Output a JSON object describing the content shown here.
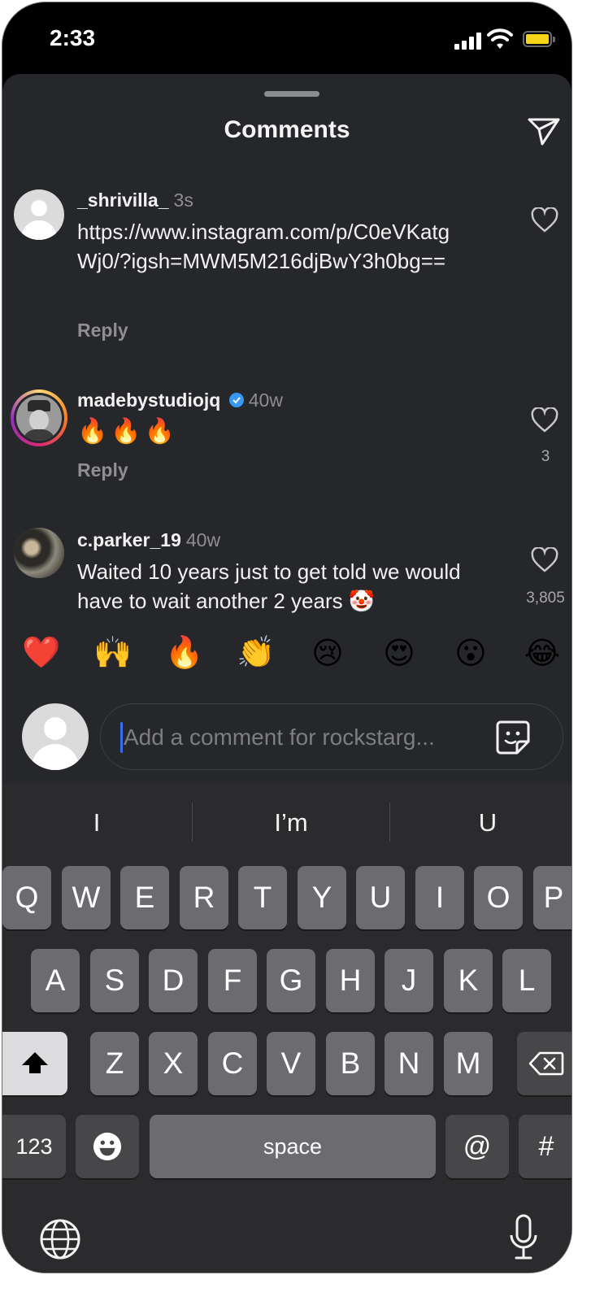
{
  "status_bar": {
    "time": "2:33"
  },
  "sheet": {
    "title": "Comments"
  },
  "comments": [
    {
      "username": "_shrivilla_",
      "ago": "3s",
      "text": "https://www.instagram.com/p/C0eVKatgWj0/?igsh=MWM5M216djBwY3h0bg==",
      "reply": "Reply",
      "likes": ""
    },
    {
      "username": "madebystudiojq",
      "verified": true,
      "ago": "40w",
      "text": "🔥🔥🔥",
      "reply": "Reply",
      "likes": "3"
    },
    {
      "username": "c.parker_19",
      "ago": "40w",
      "text": "Waited 10 years just to get told we would have to wait another 2 years 🤡",
      "likes": "3,805"
    }
  ],
  "quick_reactions": [
    "❤️",
    "🙌",
    "🔥",
    "👏",
    "😢",
    "😍",
    "😮",
    "😂"
  ],
  "composer": {
    "placeholder": "Add a comment for rockstarg..."
  },
  "keyboard": {
    "predictions": [
      "I",
      "I’m",
      "U"
    ],
    "row1": [
      "Q",
      "W",
      "E",
      "R",
      "T",
      "Y",
      "U",
      "I",
      "O",
      "P"
    ],
    "row2": [
      "A",
      "S",
      "D",
      "F",
      "G",
      "H",
      "J",
      "K",
      "L"
    ],
    "row3": [
      "Z",
      "X",
      "C",
      "V",
      "B",
      "N",
      "M"
    ],
    "numbers_key": "123",
    "space_key": "space",
    "at_key": "@",
    "hash_key": "#"
  },
  "colors": {
    "accent_caret": "#3a6cf2",
    "verified_badge": "#3897f0",
    "battery": "#f7d417"
  }
}
